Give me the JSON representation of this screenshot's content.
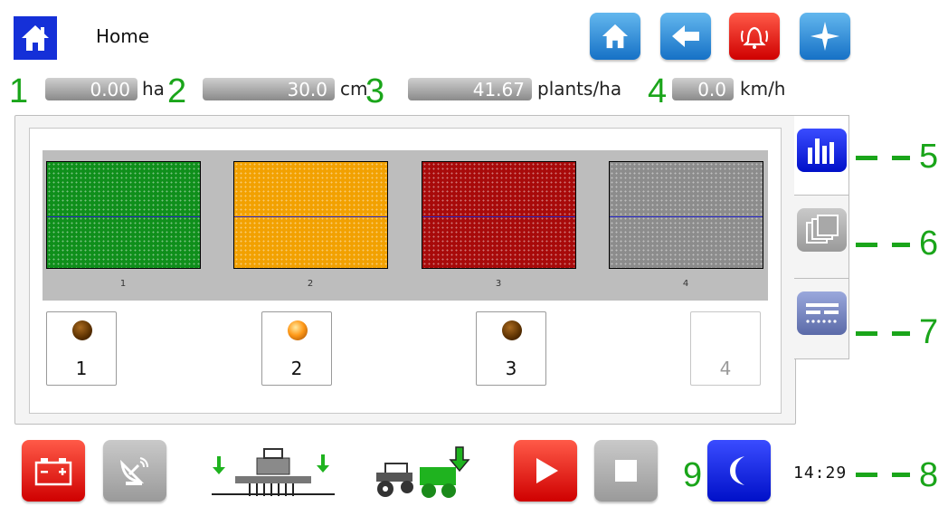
{
  "header": {
    "title": "Home",
    "icons": [
      "home-icon",
      "back-arrow-icon",
      "alarm-bell-icon",
      "compass-star-icon"
    ]
  },
  "status": {
    "area": {
      "num": "1",
      "value": "0.00",
      "unit": "ha"
    },
    "spacing": {
      "num": "2",
      "value": "30.0",
      "unit": "cm"
    },
    "population": {
      "num": "3",
      "value": "41.67",
      "unit": "plants/ha"
    },
    "speed": {
      "num": "4",
      "value": "0.0",
      "unit": "km/h"
    }
  },
  "chart_data": {
    "type": "bar",
    "categories": [
      "1",
      "2",
      "3",
      "4"
    ],
    "colors": [
      "#0f8f1b",
      "#f2a100",
      "#a80a0a",
      "#8c8c8c"
    ],
    "fill_fraction": [
      1,
      1,
      1,
      1
    ],
    "target_line_fraction": [
      0.5,
      0.5,
      0.5,
      0.5
    ]
  },
  "sections": [
    {
      "label": "1",
      "led": "off",
      "enabled": true
    },
    {
      "label": "2",
      "led": "on",
      "enabled": true
    },
    {
      "label": "3",
      "led": "off",
      "enabled": true
    },
    {
      "label": "4",
      "led": "none",
      "enabled": false
    }
  ],
  "annotations": {
    "a5": "5",
    "a6": "6",
    "a7": "7",
    "a8": "8",
    "a9": "9"
  },
  "clock": "14:29",
  "colors": {
    "accent_blue": "#1530d8",
    "annotation_green": "#1aa51a",
    "alarm_red": "#e30000"
  }
}
